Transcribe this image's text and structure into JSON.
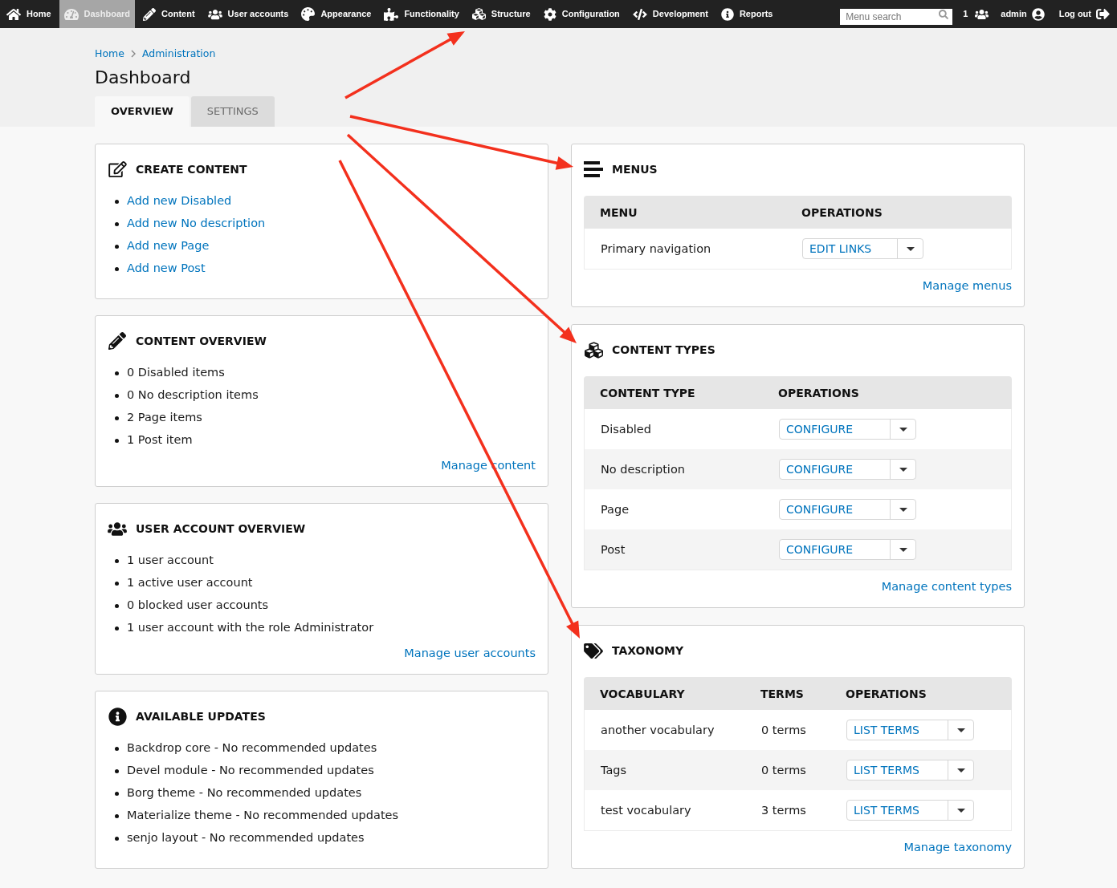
{
  "toolbar": {
    "items": [
      {
        "label": "Home",
        "selected": false
      },
      {
        "label": "Dashboard",
        "selected": true
      },
      {
        "label": "Content",
        "selected": false
      },
      {
        "label": "User accounts",
        "selected": false
      },
      {
        "label": "Appearance",
        "selected": false
      },
      {
        "label": "Functionality",
        "selected": false
      },
      {
        "label": "Structure",
        "selected": false
      },
      {
        "label": "Configuration",
        "selected": false
      },
      {
        "label": "Development",
        "selected": false
      },
      {
        "label": "Reports",
        "selected": false
      }
    ],
    "search": {
      "placeholder": "Menu search"
    },
    "online_users": "1",
    "user_name": "admin",
    "logout": "Log out"
  },
  "breadcrumb": [
    "Home",
    "Administration"
  ],
  "page_title": "Dashboard",
  "tabs": [
    {
      "label": "OVERVIEW",
      "selected": true
    },
    {
      "label": "SETTINGS",
      "selected": false
    }
  ],
  "left_column": [
    {
      "kind": "links",
      "title": "CREATE CONTENT",
      "items": [
        "Add new Disabled",
        "Add new No description",
        "Add new Page",
        "Add new Post"
      ]
    },
    {
      "kind": "text",
      "title": "CONTENT OVERVIEW",
      "items": [
        "0 Disabled items",
        "0 No description items",
        "2 Page items",
        "1 Post item"
      ],
      "footer_link": "Manage content"
    },
    {
      "kind": "text",
      "title": "USER ACCOUNT OVERVIEW",
      "items": [
        "1 user account",
        "1 active user account",
        "0 blocked user accounts",
        "1 user account with the role Administrator"
      ],
      "footer_link": "Manage user accounts"
    },
    {
      "kind": "text",
      "title": "AVAILABLE UPDATES",
      "items": [
        "Backdrop core - No recommended updates",
        "Devel module - No recommended updates",
        "Borg theme - No recommended updates",
        "Materialize theme - No recommended updates",
        "senjo layout - No recommended updates"
      ]
    }
  ],
  "right_column": [
    {
      "kind": "table",
      "title": "MENUS",
      "columns": [
        "MENU",
        "OPERATIONS"
      ],
      "rows": [
        {
          "cells": [
            "Primary navigation"
          ],
          "operation": "EDIT LINKS"
        }
      ],
      "footer_link": "Manage menus"
    },
    {
      "kind": "table",
      "title": "CONTENT TYPES",
      "columns": [
        "CONTENT TYPE",
        "OPERATIONS"
      ],
      "rows": [
        {
          "cells": [
            "Disabled"
          ],
          "operation": "CONFIGURE"
        },
        {
          "cells": [
            "No description"
          ],
          "operation": "CONFIGURE"
        },
        {
          "cells": [
            "Page"
          ],
          "operation": "CONFIGURE"
        },
        {
          "cells": [
            "Post"
          ],
          "operation": "CONFIGURE"
        }
      ],
      "footer_link": "Manage content types"
    },
    {
      "kind": "table",
      "title": "TAXONOMY",
      "columns": [
        "VOCABULARY",
        "TERMS",
        "OPERATIONS"
      ],
      "rows": [
        {
          "cells": [
            "another vocabulary",
            "0 terms"
          ],
          "operation": "LIST TERMS"
        },
        {
          "cells": [
            "Tags",
            "0 terms"
          ],
          "operation": "LIST TERMS"
        },
        {
          "cells": [
            "test vocabulary",
            "3 terms"
          ],
          "operation": "LIST TERMS"
        }
      ],
      "footer_link": "Manage taxonomy"
    }
  ]
}
